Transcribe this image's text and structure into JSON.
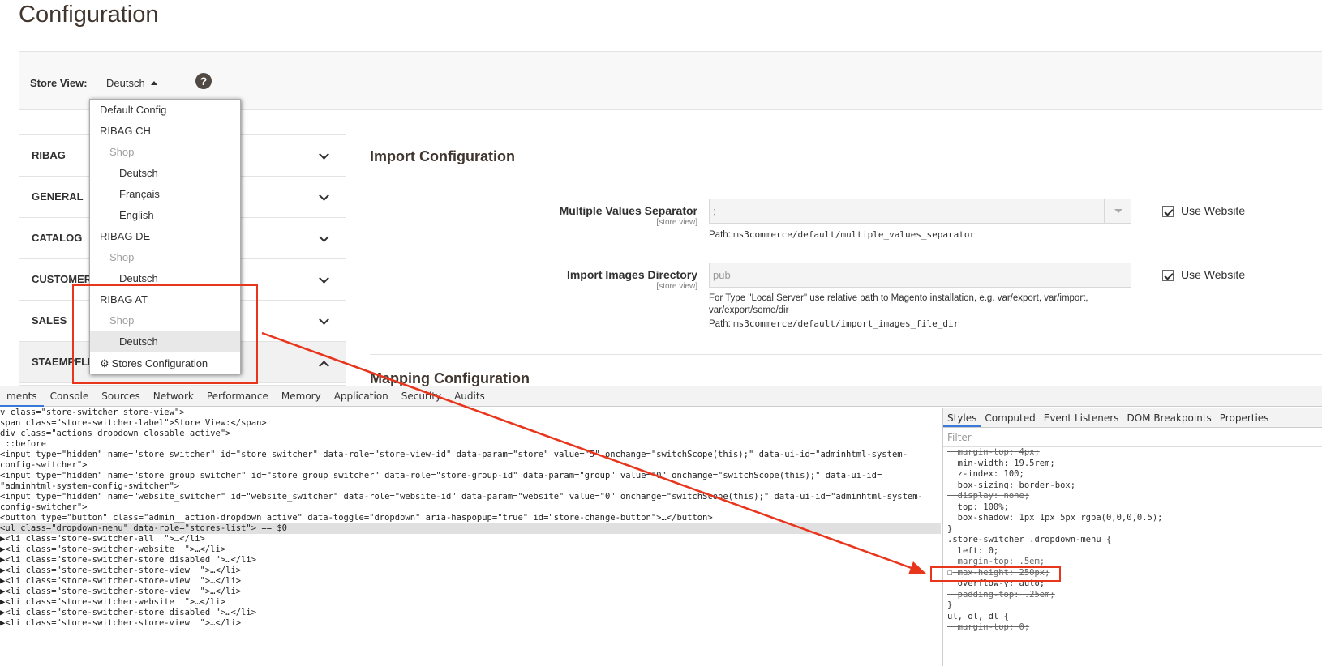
{
  "page_title": "Configuration",
  "store_switcher": {
    "label": "Store View:",
    "current": "Deutsch",
    "help": "?",
    "options": [
      {
        "label": "Default Config",
        "level": 0
      },
      {
        "label": "RIBAG CH",
        "level": 0
      },
      {
        "label": "Shop",
        "level": 1
      },
      {
        "label": "Deutsch",
        "level": 2
      },
      {
        "label": "Français",
        "level": 2
      },
      {
        "label": "English",
        "level": 2
      },
      {
        "label": "RIBAG DE",
        "level": 0
      },
      {
        "label": "Shop",
        "level": 1
      },
      {
        "label": "Deutsch",
        "level": 2
      },
      {
        "label": "RIBAG AT",
        "level": 0
      },
      {
        "label": "Shop",
        "level": 1
      },
      {
        "label": "Deutsch",
        "level": 2
      }
    ],
    "stores_configuration": "Stores Configuration"
  },
  "sidebar": {
    "items": [
      {
        "label": "RIBAG"
      },
      {
        "label": "GENERAL"
      },
      {
        "label": "CATALOG"
      },
      {
        "label": "CUSTOMERS"
      },
      {
        "label": "SALES"
      },
      {
        "label": "STAEMPFLI"
      }
    ]
  },
  "main": {
    "section_title": "Import Configuration",
    "fields": {
      "separator": {
        "label": "Multiple Values Separator",
        "scope": "[store view]",
        "value": ";",
        "path_prefix": "Path:",
        "path": "ms3commerce/default/multiple_values_separator",
        "use_website": "Use Website"
      },
      "images_dir": {
        "label": "Import Images Directory",
        "scope": "[store view]",
        "value": "pub",
        "note": "For Type \"Local Server\" use relative path to Magento installation, e.g. var/export, var/import, var/export/some/dir",
        "path_prefix": "Path:",
        "path": "ms3commerce/default/import_images_file_dir",
        "use_website": "Use Website"
      }
    },
    "section_title_2": "Mapping Configuration"
  },
  "devtools": {
    "tabs": [
      "ments",
      "Console",
      "Sources",
      "Network",
      "Performance",
      "Memory",
      "Application",
      "Security",
      "Audits"
    ],
    "styles_tabs": [
      "Styles",
      "Computed",
      "Event Listeners",
      "DOM Breakpoints",
      "Properties"
    ],
    "filter_placeholder": "Filter",
    "elements_lines": [
      "v class=\"store-switcher store-view\">",
      "span class=\"store-switcher-label\">Store View:</span>",
      "div class=\"actions dropdown closable active\">",
      " ::before",
      "<input type=\"hidden\" name=\"store_switcher\" id=\"store_switcher\" data-role=\"store-view-id\" data-param=\"store\" value=\"5\" onchange=\"switchScope(this);\" data-ui-id=\"adminhtml-system-",
      "config-switcher\">",
      "<input type=\"hidden\" name=\"store_group_switcher\" id=\"store_group_switcher\" data-role=\"store-group-id\" data-param=\"group\" value=\"0\" onchange=\"switchScope(this);\" data-ui-id=",
      "\"adminhtml-system-config-switcher\">",
      "<input type=\"hidden\" name=\"website_switcher\" id=\"website_switcher\" data-role=\"website-id\" data-param=\"website\" value=\"0\" onchange=\"switchScope(this);\" data-ui-id=\"adminhtml-system-",
      "config-switcher\">",
      "<button type=\"button\" class=\"admin__action-dropdown active\" data-toggle=\"dropdown\" aria-haspopup=\"true\" id=\"store-change-button\">…</button>",
      "<ul class=\"dropdown-menu\" data-role=\"stores-list\"> == $0",
      "▶<li class=\"store-switcher-all  \">…</li>",
      "▶<li class=\"store-switcher-website  \">…</li>",
      "▶<li class=\"store-switcher-store disabled \">…</li>",
      "▶<li class=\"store-switcher-store-view  \">…</li>",
      "▶<li class=\"store-switcher-store-view  \">…</li>",
      "▶<li class=\"store-switcher-store-view  \">…</li>",
      "▶<li class=\"store-switcher-website  \">…</li>",
      "▶<li class=\"store-switcher-store disabled \">…</li>",
      "▶<li class=\"store-switcher-store-view  \">…</li>"
    ],
    "css_lines": [
      {
        "text": "margin-top: 4px;",
        "style": "strike"
      },
      {
        "text": "min-width: 19.5rem;",
        "style": "prop"
      },
      {
        "text": "z-index: 100;",
        "style": "prop"
      },
      {
        "text": "box-sizing: border-box;",
        "style": "prop"
      },
      {
        "text": "display: none;",
        "style": "strike"
      },
      {
        "text": "top: 100%;",
        "style": "prop"
      },
      {
        "text": "box-shadow: 1px 1px 5px rgba(0,0,0,0.5);",
        "style": "prop"
      },
      {
        "text": "}",
        "style": "plain"
      },
      {
        "text": ".store-switcher .dropdown-menu {",
        "style": "selector"
      },
      {
        "text": "left: 0;",
        "style": "prop"
      },
      {
        "text": "margin-top: .5em;",
        "style": "strike"
      },
      {
        "text": "max-height: 250px;",
        "style": "strike-check"
      },
      {
        "text": "overflow-y: auto;",
        "style": "prop"
      },
      {
        "text": "padding-top: .25em;",
        "style": "strike"
      },
      {
        "text": "}",
        "style": "plain"
      },
      {
        "text": "ul, ol, dl {",
        "style": "selector"
      },
      {
        "text": "margin-top: 0;",
        "style": "strike"
      }
    ]
  }
}
